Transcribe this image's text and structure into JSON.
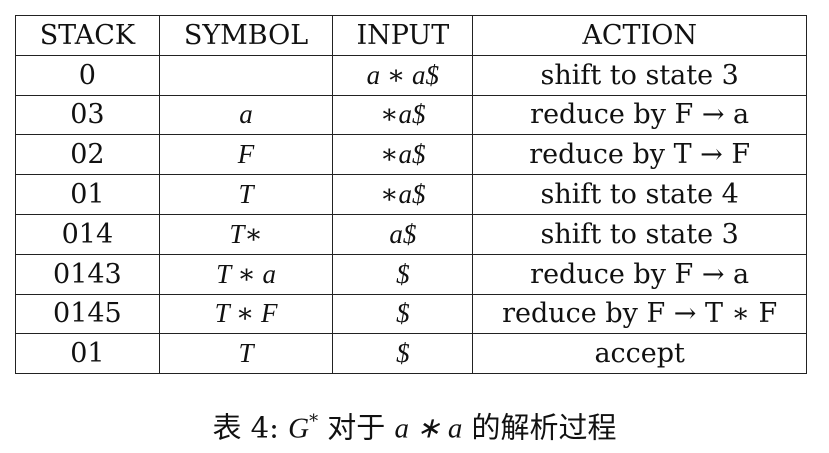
{
  "table": {
    "headers": [
      "STACK",
      "SYMBOL",
      "INPUT",
      "ACTION"
    ],
    "rows": [
      {
        "stack": "0",
        "symbol": "",
        "input": "a ∗ a$",
        "action": "shift to state 3"
      },
      {
        "stack": "03",
        "symbol": "a",
        "input": "∗a$",
        "action": "reduce by F → a"
      },
      {
        "stack": "02",
        "symbol": "F",
        "input": "∗a$",
        "action": "reduce by T → F"
      },
      {
        "stack": "01",
        "symbol": "T",
        "input": "∗a$",
        "action": "shift to state 4"
      },
      {
        "stack": "014",
        "symbol": "T∗",
        "input": "a$",
        "action": "shift to state 3"
      },
      {
        "stack": "0143",
        "symbol": "T ∗ a",
        "input": "$",
        "action": "reduce by F → a"
      },
      {
        "stack": "0145",
        "symbol": "T ∗ F",
        "input": "$",
        "action": "reduce by F → T ∗ F"
      },
      {
        "stack": "01",
        "symbol": "T",
        "input": "$",
        "action": "accept"
      }
    ]
  },
  "caption": {
    "label": "表 4:",
    "grammar": "G",
    "superscript": "*",
    "text_1": "对于",
    "expression": "a ∗ a",
    "text_2": "的解析过程"
  }
}
